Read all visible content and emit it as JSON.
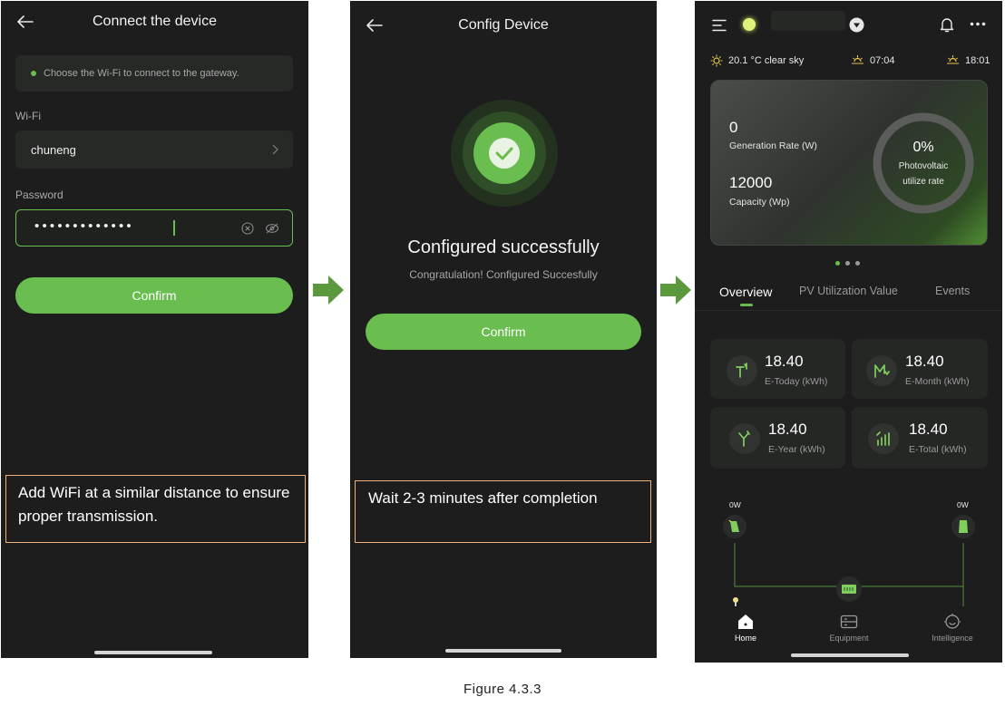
{
  "screen1": {
    "title": "Connect the device",
    "hint": "Choose the Wi-Fi to connect to the gateway.",
    "wifi_label": "Wi-Fi",
    "wifi_value": "chuneng",
    "password_label": "Password",
    "password_value": "•••••••••••••",
    "confirm": "Confirm",
    "note": "Add WiFi at a similar distance to ensure proper transmission."
  },
  "screen2": {
    "title": "Config Device",
    "success_title": "Configured successfully",
    "success_sub": "Congratulation! Configured Succesfully",
    "confirm": "Confirm",
    "note": "Wait 2-3 minutes after completion"
  },
  "screen3": {
    "weather": "20.1 °C clear sky",
    "sunrise": "07:04",
    "sunset": "18:01",
    "generation_value": "0",
    "generation_label": "Generation Rate (W)",
    "capacity_value": "12000",
    "capacity_label": "Capacity (Wp)",
    "utilize_value": "0%",
    "utilize_label_1": "Photovoltaic",
    "utilize_label_2": "utilize rate",
    "tabs": [
      "Overview",
      "PV Utilization Value",
      "Events"
    ],
    "stats": [
      {
        "value": "18.40",
        "label": "E-Today (kWh)"
      },
      {
        "value": "18.40",
        "label": "E-Month (kWh)"
      },
      {
        "value": "18.40",
        "label": "E-Year (kWh)"
      },
      {
        "value": "18.40",
        "label": "E-Total (kWh)"
      }
    ],
    "flow_left": "0W",
    "flow_right": "0W",
    "nav": [
      "Home",
      "Equipment",
      "Intelligence"
    ]
  },
  "caption": "Figure 4.3.3",
  "colors": {
    "accent": "#6abd4f",
    "bg": "#1c1d1c",
    "note_border": "#f0b27a",
    "arrow": "#5b9a3c"
  }
}
